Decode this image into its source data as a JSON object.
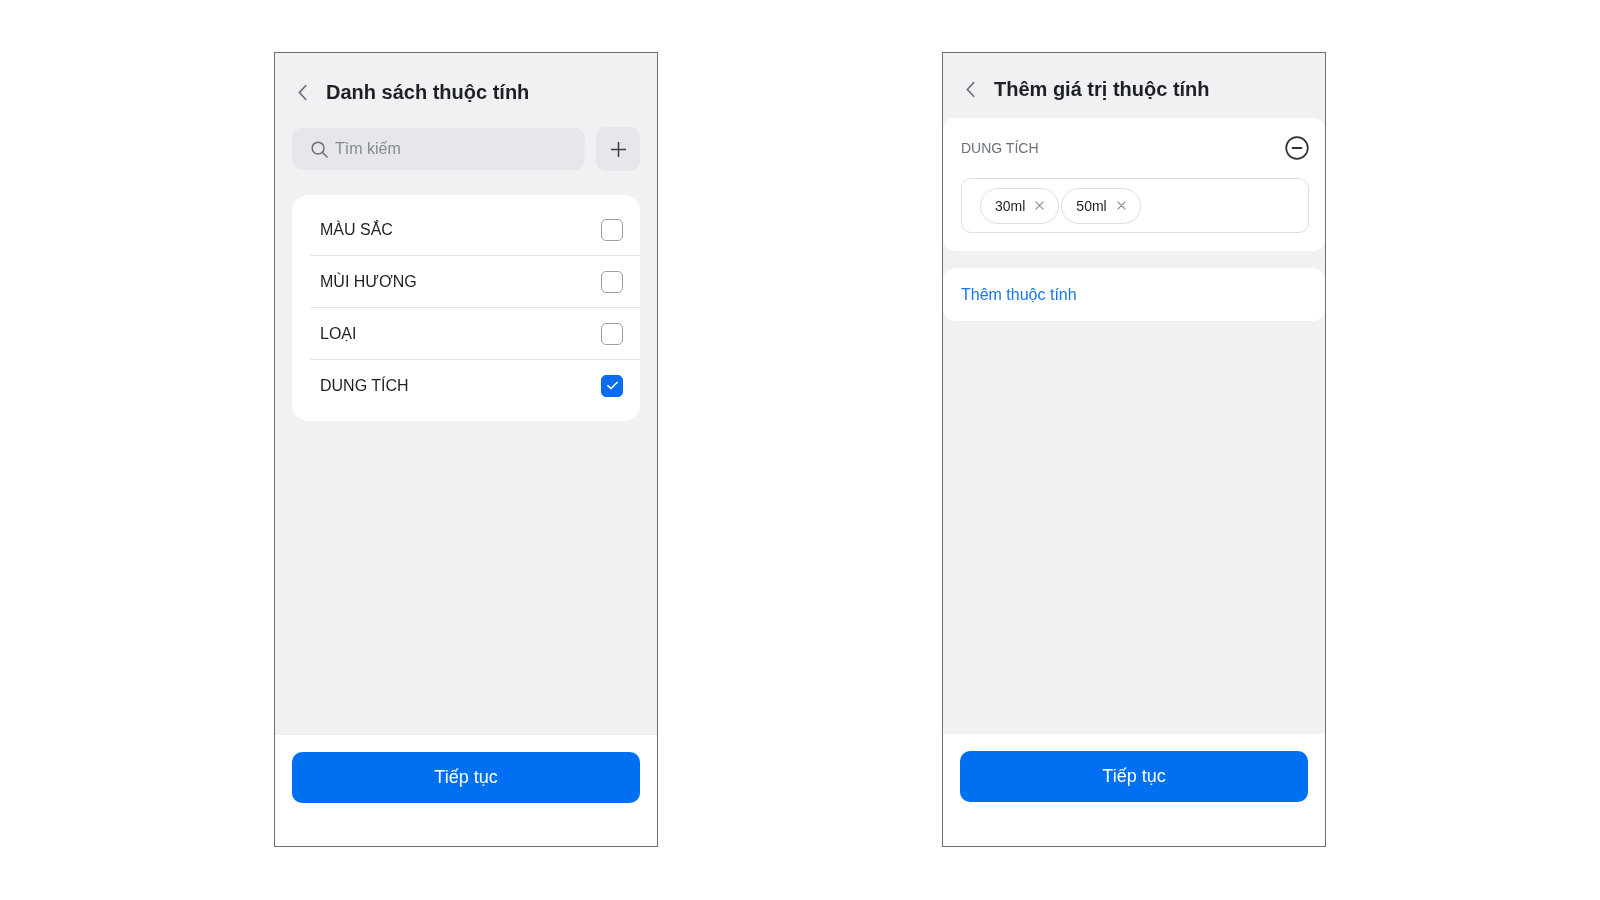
{
  "attribute_list_screen": {
    "title": "Danh sách thuộc tính",
    "search": {
      "placeholder": "Tìm kiếm"
    },
    "attributes": [
      {
        "label": "MÀU SẮC",
        "checked": false
      },
      {
        "label": "MÙI HƯƠNG",
        "checked": false
      },
      {
        "label": "LOẠI",
        "checked": false
      },
      {
        "label": "DUNG TÍCH",
        "checked": true
      }
    ],
    "continue_button": "Tiếp tục"
  },
  "attribute_values_screen": {
    "title": "Thêm giá trị thuộc tính",
    "groups": [
      {
        "label": "DUNG TÍCH",
        "values": [
          "30ml",
          "50ml"
        ]
      }
    ],
    "add_attribute_link": "Thêm thuộc tính",
    "continue_button": "Tiếp tục"
  }
}
